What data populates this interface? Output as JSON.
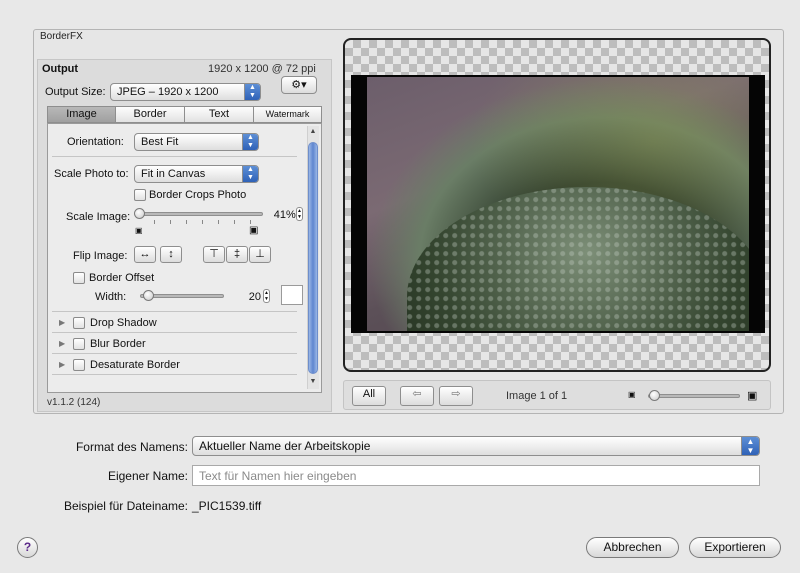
{
  "plugin": {
    "title": "BorderFX",
    "output_label": "Output",
    "output_info": "1920 x 1200 @ 72 ppi",
    "output_size_label": "Output Size:",
    "output_size_value": "JPEG – 1920 x 1200",
    "gear_icon": "gear-icon",
    "tabs": [
      {
        "label": "Image",
        "selected": true
      },
      {
        "label": "Border",
        "selected": false
      },
      {
        "label": "Text",
        "selected": false
      },
      {
        "label": "Watermark",
        "selected": false
      }
    ],
    "orientation_label": "Orientation:",
    "orientation_value": "Best Fit",
    "scale_photo_label": "Scale Photo to:",
    "scale_photo_value": "Fit in Canvas",
    "border_crops_label": "Border Crops Photo",
    "scale_image_label": "Scale Image:",
    "scale_image_value": "41",
    "scale_image_unit": "%",
    "flip_image_label": "Flip Image:",
    "border_offset_label": "Border Offset",
    "width_label": "Width:",
    "width_value": "20",
    "sections": [
      "Drop Shadow",
      "Blur Border",
      "Desaturate Border"
    ],
    "version": "v1.1.2 (124)"
  },
  "preview": {
    "all_label": "All",
    "counter": "Image 1 of 1"
  },
  "form": {
    "format_label": "Format des Namens:",
    "format_value": "Aktueller Name der Arbeitskopie",
    "custom_name_label": "Eigener Name:",
    "custom_name_placeholder": "Text für Namen hier eingeben",
    "example_label": "Beispiel für Dateiname:",
    "example_value": "_PIC1539.tiff"
  },
  "buttons": {
    "help": "?",
    "cancel": "Abbrechen",
    "export": "Exportieren"
  }
}
